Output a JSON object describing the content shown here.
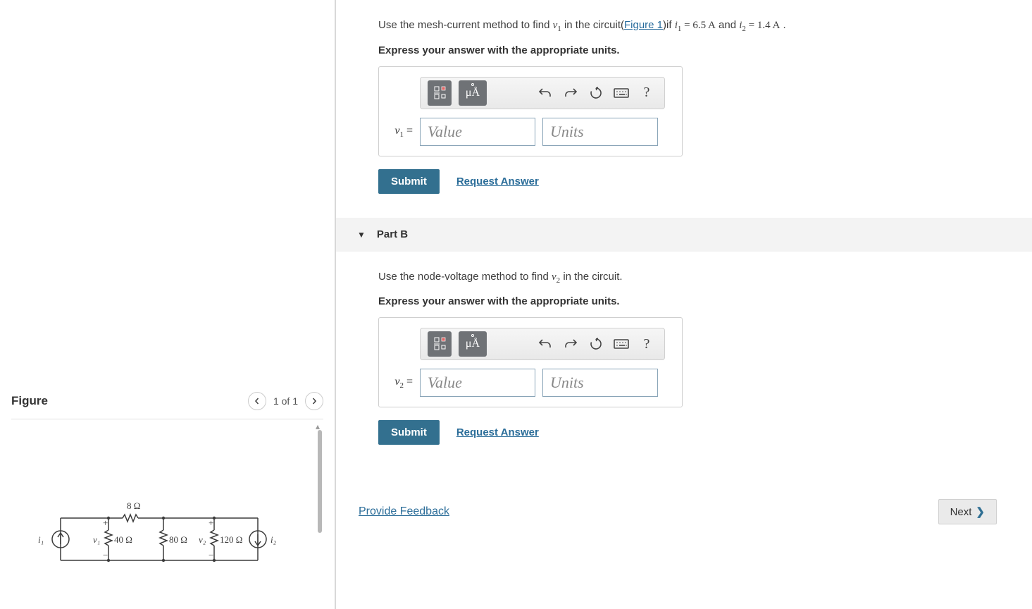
{
  "figure": {
    "title": "Figure",
    "counter": "1 of 1",
    "labels": {
      "r_top": "8 Ω",
      "i1": "i₁",
      "i2": "i₂",
      "v1": "v₁",
      "v2": "v₂",
      "r40": "40 Ω",
      "r80": "80 Ω",
      "r120": "120 Ω"
    }
  },
  "partA": {
    "prompt_pre": "Use the mesh-current method to find ",
    "prompt_var": "v",
    "prompt_sub": "1",
    "prompt_mid": " in the circuit(",
    "figure_link": "Figure 1",
    "prompt_after_link": ")if ",
    "i1_var": "i",
    "i1_sub": "1",
    "i1_val": " = 6.5 A",
    "and": " and ",
    "i2_var": "i",
    "i2_sub": "2",
    "i2_val": " = 1.4 A",
    "tail": " .",
    "express": "Express your answer with the appropriate units.",
    "answer_var": "v",
    "answer_sub": "1",
    "equals": " = ",
    "value_placeholder": "Value",
    "units_placeholder": "Units",
    "submit": "Submit",
    "request": "Request Answer",
    "unit_btn": "μÅ"
  },
  "partB": {
    "header": "Part B",
    "prompt_pre": "Use the node-voltage method to find ",
    "prompt_var": "v",
    "prompt_sub": "2",
    "prompt_post": " in the circuit.",
    "express": "Express your answer with the appropriate units.",
    "answer_var": "v",
    "answer_sub": "2",
    "equals": " = ",
    "value_placeholder": "Value",
    "units_placeholder": "Units",
    "submit": "Submit",
    "request": "Request Answer",
    "unit_btn": "μÅ"
  },
  "footer": {
    "feedback": "Provide Feedback",
    "next": "Next"
  }
}
